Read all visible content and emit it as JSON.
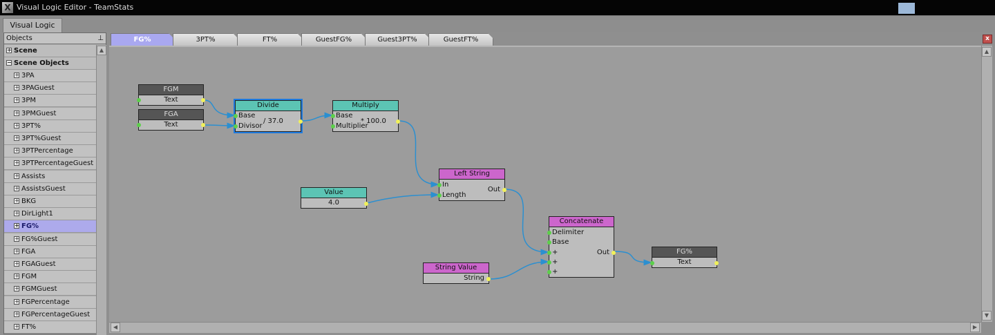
{
  "window": {
    "title": "Visual Logic Editor - TeamStats"
  },
  "doc_tab": "Visual Logic",
  "sidebar": {
    "title": "Objects",
    "groups": [
      "Scene",
      "Scene Objects"
    ],
    "items": [
      "3PA",
      "3PAGuest",
      "3PM",
      "3PMGuest",
      "3PT%",
      "3PT%Guest",
      "3PTPercentage",
      "3PTPercentageGuest",
      "Assists",
      "AssistsGuest",
      "BKG",
      "DirLight1",
      "FG%",
      "FG%Guest",
      "FGA",
      "FGAGuest",
      "FGM",
      "FGMGuest",
      "FGPercentage",
      "FGPercentageGuest",
      "FT%"
    ],
    "selected": "FG%"
  },
  "tabs": [
    "FG%",
    "3PT%",
    "FT%",
    "GuestFG%",
    "Guest3PT%",
    "GuestFT%"
  ],
  "active_tab": "FG%",
  "nodes": {
    "fgm": {
      "title": "FGM",
      "port": "Text"
    },
    "fga": {
      "title": "FGA",
      "port": "Text"
    },
    "divide": {
      "title": "Divide",
      "in1": "Base",
      "in2": "Divisor",
      "value": "/ 37.0"
    },
    "multiply": {
      "title": "Multiply",
      "in1": "Base",
      "in2": "Multiplier",
      "value": "* 100.0"
    },
    "value": {
      "title": "Value",
      "value": "4.0"
    },
    "left": {
      "title": "Left String",
      "in1": "In",
      "in2": "Length",
      "out": "Out"
    },
    "concat": {
      "title": "Concatenate",
      "in1": "Delimiter",
      "in2": "Base",
      "in3": "+",
      "in4": "+",
      "in5": "+",
      "out": "Out"
    },
    "strval": {
      "title": "String Value",
      "out": "String"
    },
    "fgpct": {
      "title": "FG%",
      "port": "Text"
    }
  },
  "colors": {
    "accent": "#1e7be0",
    "wire": "#2b8fd0",
    "teal": "#5cc4b4",
    "pink": "#cc66cc",
    "tab_active": "#a9a8f0"
  }
}
